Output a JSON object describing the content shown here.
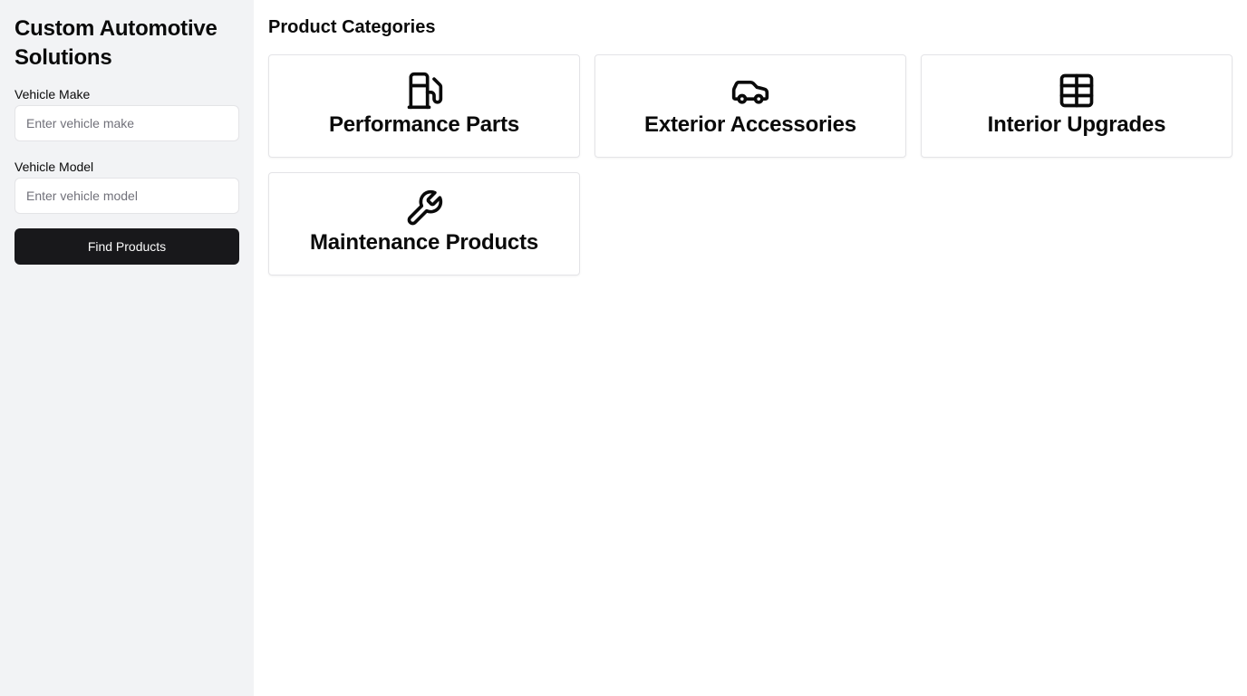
{
  "sidebar": {
    "title": "Custom Automotive Solutions",
    "make": {
      "label": "Vehicle Make",
      "placeholder": "Enter vehicle make",
      "value": ""
    },
    "model": {
      "label": "Vehicle Model",
      "placeholder": "Enter vehicle model",
      "value": ""
    },
    "submit_label": "Find Products",
    "background": "#f2f3f5",
    "button_color": "#18181b"
  },
  "main": {
    "title": "Product Categories",
    "categories": [
      {
        "label": "Performance Parts",
        "icon": "fuel-pump-icon"
      },
      {
        "label": "Exterior Accessories",
        "icon": "car-icon"
      },
      {
        "label": "Interior Upgrades",
        "icon": "grid-icon"
      },
      {
        "label": "Maintenance Products",
        "icon": "wrench-icon"
      }
    ]
  }
}
